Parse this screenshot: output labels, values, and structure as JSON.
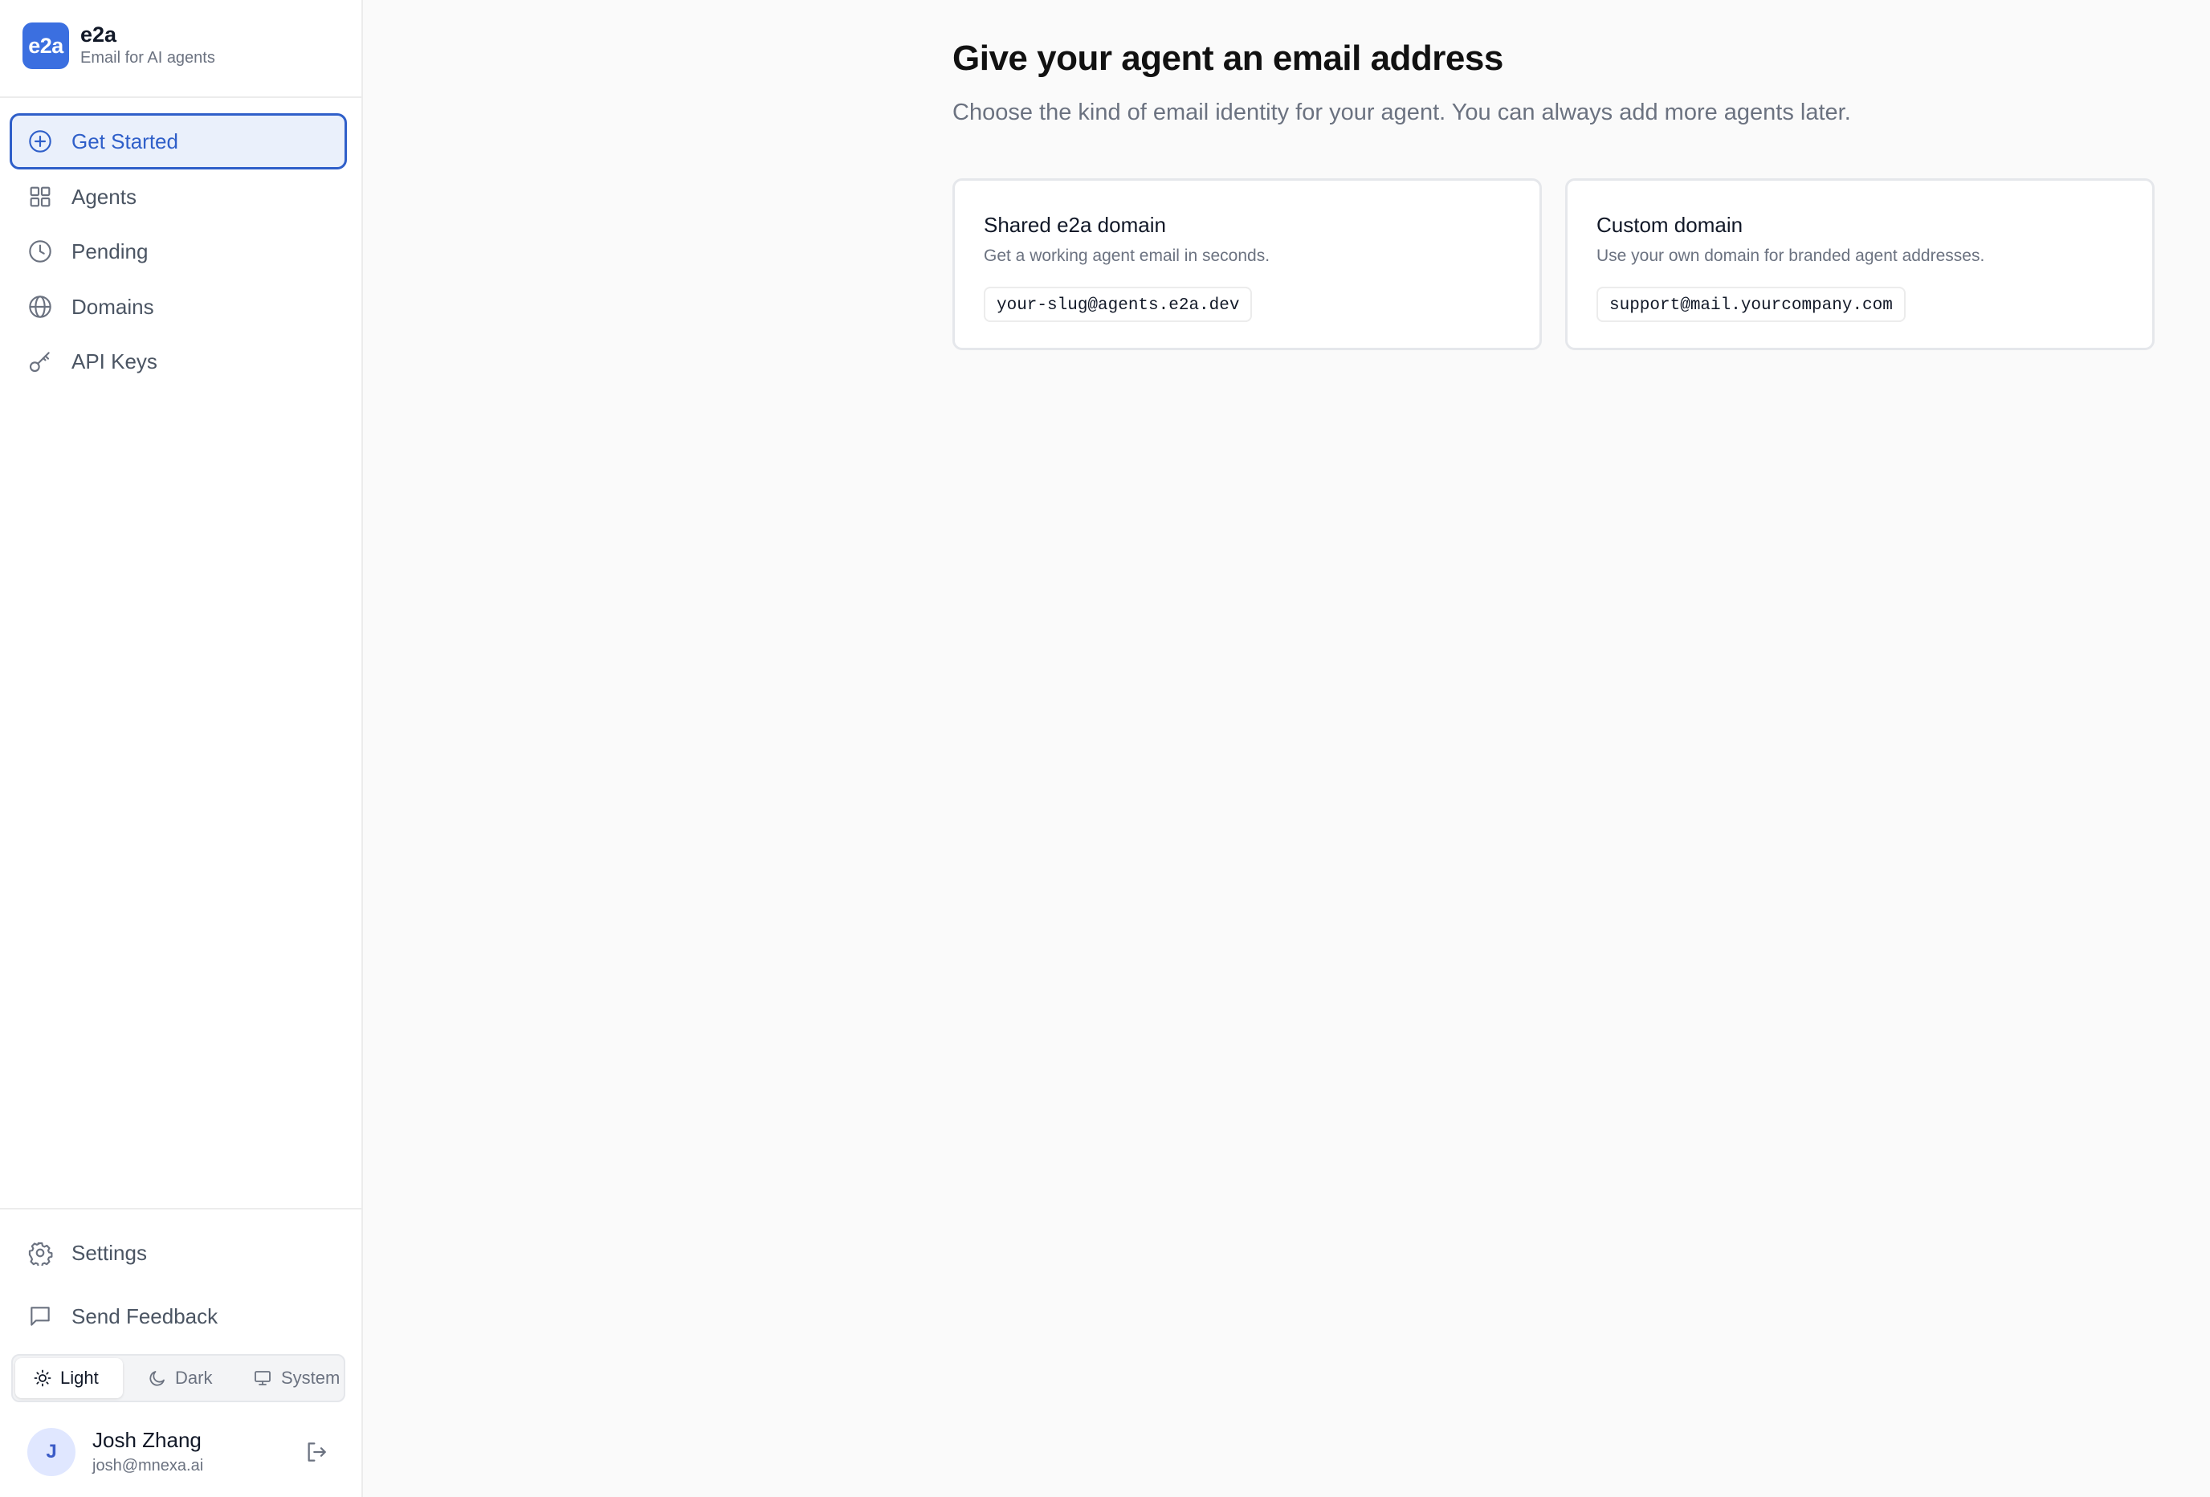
{
  "brand": {
    "logo_text": "e2a",
    "name": "e2a",
    "tagline": "Email for AI agents",
    "accent_color": "#3b6fe0"
  },
  "nav": {
    "items": [
      {
        "label": "Get Started",
        "icon": "plus-circle-icon",
        "active": true
      },
      {
        "label": "Agents",
        "icon": "grid-icon",
        "active": false
      },
      {
        "label": "Pending",
        "icon": "clock-icon",
        "active": false
      },
      {
        "label": "Domains",
        "icon": "globe-icon",
        "active": false
      },
      {
        "label": "API Keys",
        "icon": "key-icon",
        "active": false
      }
    ]
  },
  "sidebar_footer": {
    "settings_label": "Settings",
    "feedback_label": "Send Feedback",
    "theme": {
      "options": [
        "Light",
        "Dark",
        "System"
      ],
      "selected": "Light"
    }
  },
  "user": {
    "initial": "J",
    "name": "Josh Zhang",
    "email": "josh@mnexa.ai"
  },
  "main": {
    "title": "Give your agent an email address",
    "subtitle": "Choose the kind of email identity for your agent. You can always add more agents later.",
    "cards": [
      {
        "title": "Shared e2a domain",
        "description": "Get a working agent email in seconds.",
        "example": "your-slug@agents.e2a.dev"
      },
      {
        "title": "Custom domain",
        "description": "Use your own domain for branded agent addresses.",
        "example": "support@mail.yourcompany.com"
      }
    ]
  }
}
